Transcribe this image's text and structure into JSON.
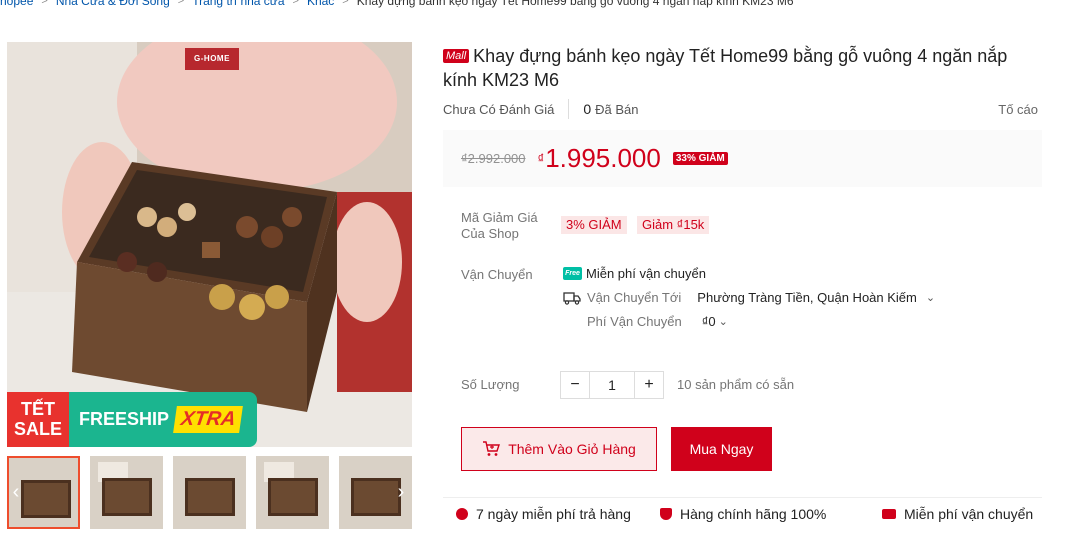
{
  "breadcrumb": [
    "hopee",
    "Nhà Cửa & Đời Sống",
    "Trang trí nhà cửa",
    "Khác",
    "Khay đựng bánh kẹo ngày Tết Home99 bằng gỗ vuông 4 ngăn nắp kính KM23 M6"
  ],
  "gallery": {
    "brand_tag": "G-HOME",
    "banner_tet": "TẾT SALE",
    "banner_free": "FREESHIP",
    "banner_xtra": "XTRA",
    "prev_arrow": "‹",
    "next_arrow": "›"
  },
  "product": {
    "mall_badge": "Mall",
    "title": "Khay đựng bánh kẹo ngày Tết Home99 bằng gỗ vuông 4 ngăn nắp kính KM23 M6",
    "rating_text": "Chưa Có Đánh Giá",
    "sold_count": "0",
    "sold_label": "Đã Bán",
    "report": "Tố cáo"
  },
  "price": {
    "old": "₫2.992.000",
    "currency": "₫",
    "current": "1.995.000",
    "discount": "33% GIẢM"
  },
  "vouchers": {
    "label": "Mã Giảm Giá Của Shop",
    "items": [
      "3% GIẢM",
      "Giảm ₫15k"
    ]
  },
  "shipping": {
    "label": "Vận Chuyển",
    "free_icon": "Free",
    "free_text": "Miễn phí vận chuyển",
    "to_label": "Vận Chuyển Tới",
    "to_value": "Phường Tràng Tiền, Quận Hoàn Kiếm",
    "fee_label": "Phí Vận Chuyển",
    "fee_value": "₫0"
  },
  "quantity": {
    "label": "Số Lượng",
    "minus": "−",
    "value": "1",
    "plus": "+",
    "stock": "10 sản phẩm có sẵn"
  },
  "actions": {
    "add_to_cart": "Thêm Vào Giỏ Hàng",
    "buy_now": "Mua Ngay"
  },
  "guarantees": [
    "7 ngày miễn phí trả hàng",
    "Hàng chính hãng 100%",
    "Miễn phí vận chuyển"
  ],
  "colors": {
    "accent": "#d0011b",
    "voucher_bg": "#fbe6e6",
    "free_ship": "#00bfa5"
  }
}
